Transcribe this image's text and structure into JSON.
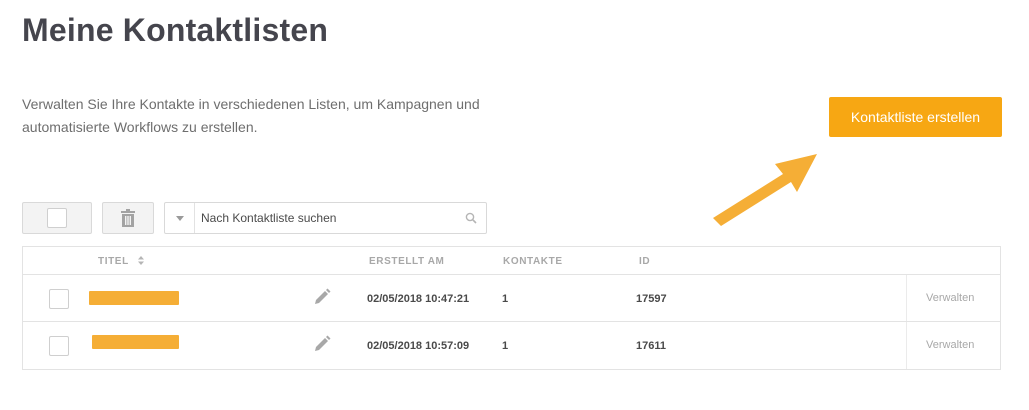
{
  "page": {
    "title": "Meine Kontaktlisten",
    "description": "Verwalten Sie Ihre Kontakte in verschiedenen Listen, um Kampagnen und automatisierte Workflows zu erstellen.",
    "create_button_label": "Kontaktliste erstellen"
  },
  "colors": {
    "accent": "#f7a713",
    "arrow": "#f5ae36"
  },
  "toolbar": {
    "search_placeholder": "Nach Kontaktliste suchen",
    "icons": [
      "checkbox",
      "trash-icon",
      "chevron-down-icon",
      "search-icon"
    ]
  },
  "table": {
    "columns": {
      "title": "TITEL",
      "created": "ERSTELLT AM",
      "contacts": "KONTAKTE",
      "id": "ID"
    },
    "rows": [
      {
        "created": "02/05/2018 10:47:21",
        "contacts": "1",
        "id": "17597",
        "action": "Verwalten"
      },
      {
        "created": "02/05/2018 10:57:09",
        "contacts": "1",
        "id": "17611",
        "action": "Verwalten"
      }
    ]
  }
}
